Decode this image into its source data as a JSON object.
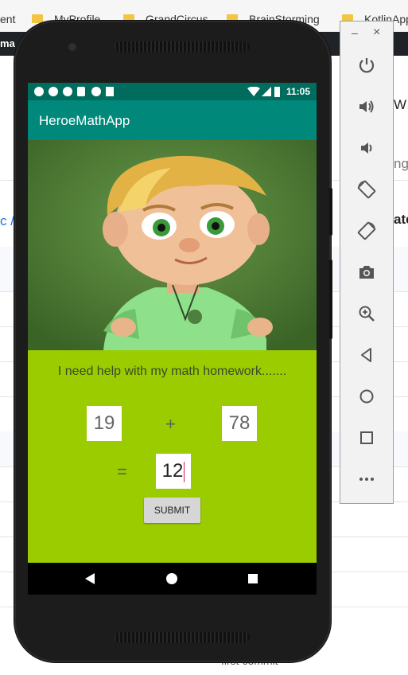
{
  "bookmarks": [
    {
      "label": "ent"
    },
    {
      "label": "MyProfile"
    },
    {
      "label": "GrandCircus"
    },
    {
      "label": "BrainStorming"
    },
    {
      "label": "KotlinApp"
    }
  ],
  "background": {
    "dark_strip_text": "ma",
    "breadcrumb_fragment": "c /",
    "bottom_fragment": "first commit",
    "right_peek": [
      "W",
      "ng",
      "ate"
    ]
  },
  "phone": {
    "status_time": "11:05",
    "app_title": "HeroeMathApp",
    "question": "I need help with my math homework.......",
    "first_number": "19",
    "operator": "+",
    "second_number": "78",
    "equals": "=",
    "answer_value": "12",
    "submit_label": "SUBMIT"
  },
  "emulator_toolbar": {
    "minimize": "–",
    "close": "×",
    "tools": [
      "power-icon",
      "volume-up-icon",
      "volume-down-icon",
      "rotate-left-icon",
      "rotate-right-icon",
      "camera-icon",
      "zoom-in-icon",
      "back-icon",
      "home-icon",
      "overview-icon",
      "more-icon"
    ]
  },
  "colors": {
    "app_bar": "#00897b",
    "status_bar": "#006c5d",
    "content_bg": "#9bcc00"
  }
}
